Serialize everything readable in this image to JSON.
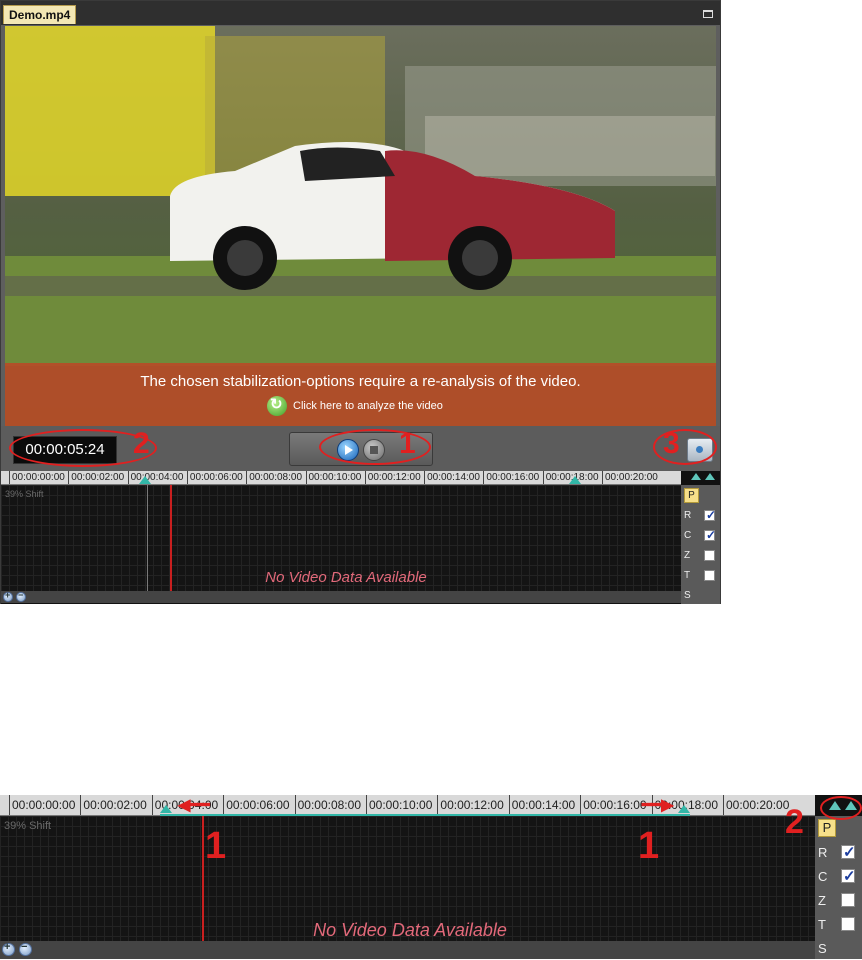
{
  "player": {
    "file_tab": "Demo.mp4",
    "banner_message": "The chosen stabilization-options require a re-analysis of the video.",
    "analyze_link": "Click here to analyze the video",
    "timecode": "00:00:05:24"
  },
  "timeline": {
    "ticks": [
      "00:00:00:00",
      "00:00:02:00",
      "00:00:04:00",
      "00:00:06:00",
      "00:00:08:00",
      "00:00:10:00",
      "00:00:12:00",
      "00:00:14:00",
      "00:00:16:00",
      "00:00:18:00",
      "00:00:20:00"
    ],
    "shift_label": "39% Shift",
    "no_data": "No Video Data Available",
    "channels": [
      {
        "label": "P",
        "checkbox": false,
        "checked": false
      },
      {
        "label": "R",
        "checkbox": true,
        "checked": true
      },
      {
        "label": "C",
        "checkbox": true,
        "checked": true
      },
      {
        "label": "Z",
        "checkbox": true,
        "checked": false
      },
      {
        "label": "T",
        "checkbox": true,
        "checked": false
      },
      {
        "label": "S",
        "checkbox": false,
        "checked": false
      }
    ]
  },
  "callouts_top": {
    "transport": "1",
    "timecode": "2",
    "snapshot": "3"
  },
  "callouts_bottom": {
    "range_start": "1",
    "range_end": "1",
    "range_buttons": "2"
  },
  "colors": {
    "accent_teal": "#32b7a8",
    "playhead": "#c91f1f",
    "callout": "#e02020",
    "banner": "#b64c28"
  }
}
